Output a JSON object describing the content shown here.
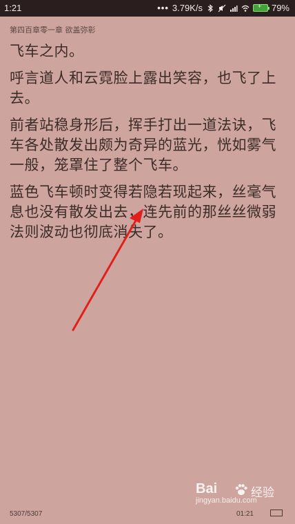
{
  "status_bar": {
    "time": "1:21",
    "network_speed": "3.79K/s",
    "battery_percent": "79%",
    "icons": [
      "more-dots-icon",
      "bluetooth-icon",
      "mute-icon",
      "signal-icon",
      "wifi-icon",
      "battery-icon"
    ]
  },
  "reader": {
    "chapter_title": "第四百章零一章 欲盖弥彰",
    "paragraphs": [
      "飞车之内。",
      "呼言道人和云霓脸上露出笑容，也飞了上去。",
      "前者站稳身形后，挥手打出一道法诀，飞车各处散发出颇为奇异的蓝光，恍如雾气一般，笼罩住了整个飞车。",
      "蓝色飞车顿时变得若隐若现起来，丝毫气息也没有散发出去，连先前的那丝丝微弱法则波动也彻底消失了。"
    ],
    "page_counter": "5307/5307",
    "bottom_clock": "01:21"
  },
  "watermark": {
    "brand": "Bai",
    "product": "经验",
    "url": "jingyan.baidu.com"
  },
  "colors": {
    "background": "#cea59e",
    "status_bar": "#2a1f1e",
    "text": "#3d2b28",
    "arrow": "#e0201b"
  }
}
